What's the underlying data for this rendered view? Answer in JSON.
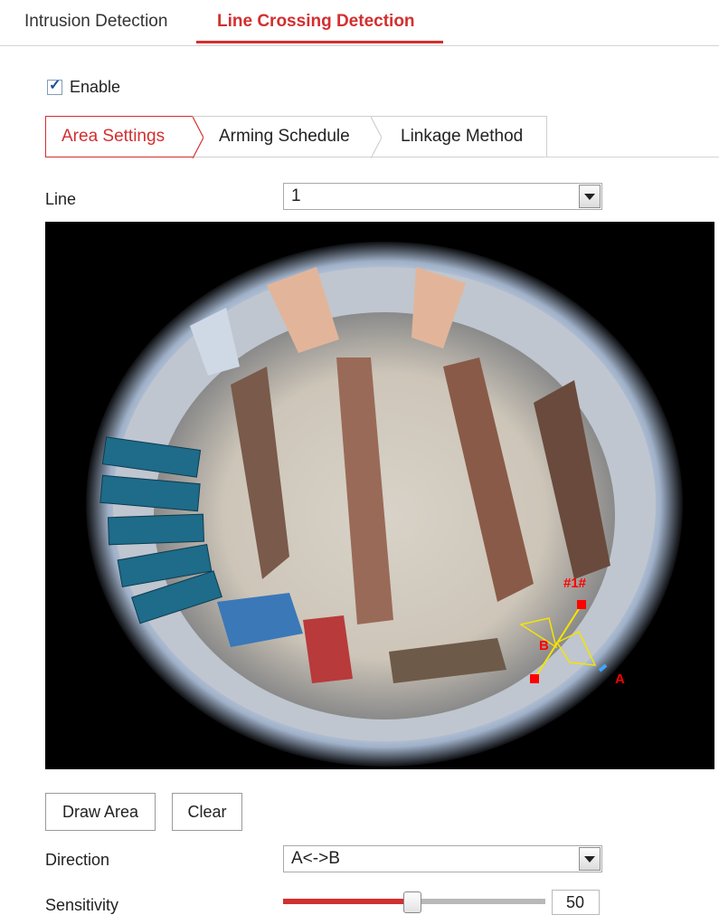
{
  "tabs": {
    "intrusion": "Intrusion Detection",
    "line_crossing": "Line Crossing Detection",
    "active": "Line Crossing Detection"
  },
  "enable": {
    "label": "Enable",
    "checked": true
  },
  "subtabs": {
    "area": "Area Settings",
    "arming": "Arming Schedule",
    "linkage": "Linkage Method",
    "active": "Area Settings"
  },
  "line": {
    "label": "Line",
    "value": "1"
  },
  "overlay": {
    "line_id": "#1#",
    "point_a": "A",
    "point_b": "B"
  },
  "buttons": {
    "draw": "Draw Area",
    "clear": "Clear"
  },
  "direction": {
    "label": "Direction",
    "value": "A<->B"
  },
  "sensitivity": {
    "label": "Sensitivity",
    "value": "50",
    "level_percent": 50
  },
  "colors": {
    "accent": "#d32f2f",
    "overlay_line": "#f5e400",
    "overlay_marker": "#ff0000"
  }
}
